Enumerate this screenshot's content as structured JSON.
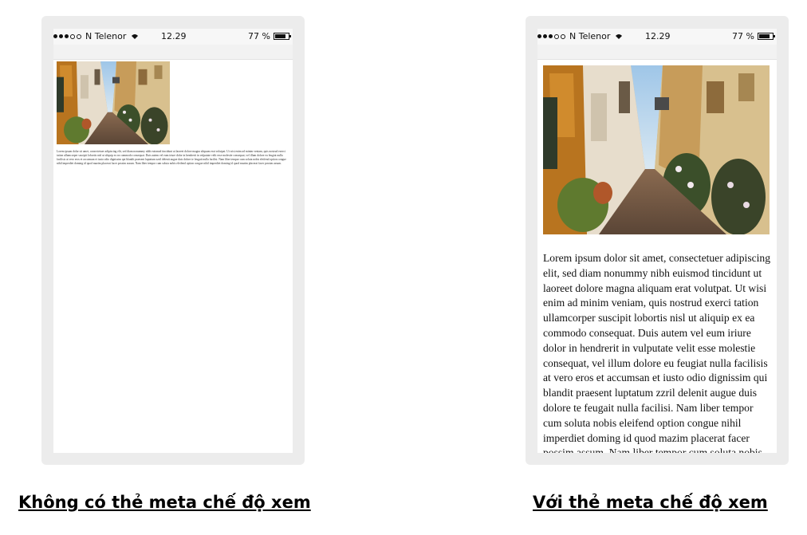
{
  "status_bar": {
    "carrier": "N Telenor",
    "time": "12.29",
    "battery_text": "77 %",
    "battery_level": 0.77,
    "signal_filled": 3,
    "signal_total": 5
  },
  "body_text": "Lorem ipsum dolor sit amet, consectetuer adipiscing elit, sed diam nonummy nibh euismod tincidunt ut laoreet dolore magna aliquam erat volutpat. Ut wisi enim ad minim veniam, quis nostrud exerci tation ullamcorper suscipit lobortis nisl ut aliquip ex ea commodo consequat. Duis autem vel eum iriure dolor in hendrerit in vulputate velit esse molestie consequat, vel illum dolore eu feugiat nulla facilisis at vero eros et accumsan et iusto odio dignissim qui blandit praesent luptatum zzril delenit augue duis dolore te feugait nulla facilisi. Nam liber tempor cum soluta nobis eleifend option congue nihil imperdiet doming id quod mazim placerat facer possim assum. Nam liber tempor cum soluta nobis eleifend option congue nihil imperdiet doming id quod mazim placerat facer possim assum.",
  "captions": {
    "without_meta": "Không có thẻ meta chế độ xem",
    "with_meta": "Với thẻ meta chế độ xem"
  },
  "icons": {
    "wifi": "wifi-icon",
    "battery": "battery-icon",
    "photo": "alley-photo"
  }
}
